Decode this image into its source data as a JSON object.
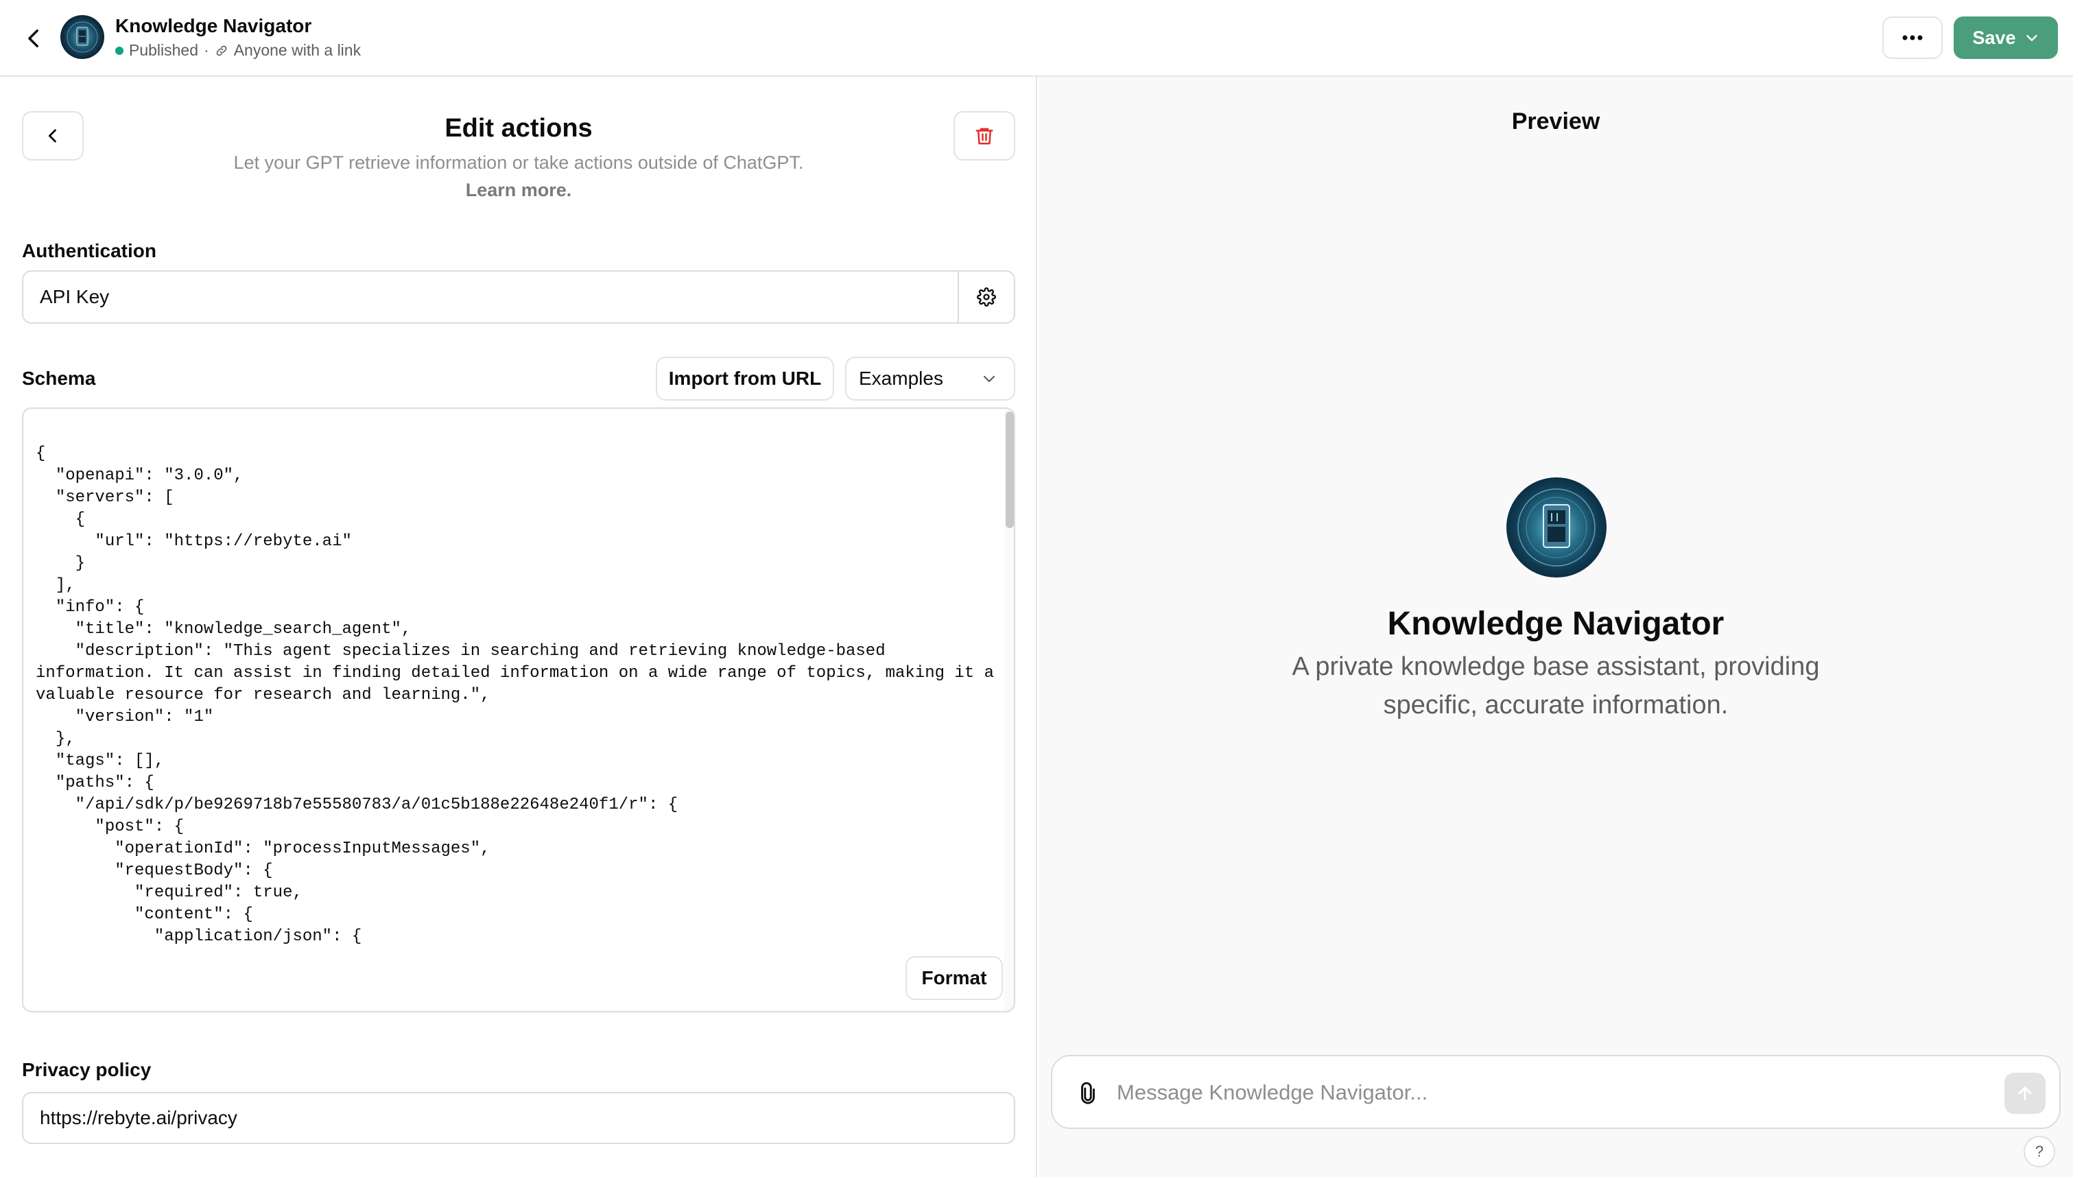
{
  "header": {
    "title": "Knowledge Navigator",
    "status": "Published",
    "separator": "·",
    "visibility": "Anyone with a link",
    "save_label": "Save"
  },
  "editor": {
    "title": "Edit actions",
    "subtitle": "Let your GPT retrieve information or take actions outside of ChatGPT.",
    "learn_more": "Learn more.",
    "authentication": {
      "label": "Authentication",
      "value": "API Key"
    },
    "schema": {
      "label": "Schema",
      "import_label": "Import from URL",
      "examples_label": "Examples",
      "format_label": "Format",
      "code": "{\n  \"openapi\": \"3.0.0\",\n  \"servers\": [\n    {\n      \"url\": \"https://rebyte.ai\"\n    }\n  ],\n  \"info\": {\n    \"title\": \"knowledge_search_agent\",\n    \"description\": \"This agent specializes in searching and retrieving knowledge-based information. It can assist in finding detailed information on a wide range of topics, making it a valuable resource for research and learning.\",\n    \"version\": \"1\"\n  },\n  \"tags\": [],\n  \"paths\": {\n    \"/api/sdk/p/be9269718b7e55580783/a/01c5b188e22648e240f1/r\": {\n      \"post\": {\n        \"operationId\": \"processInputMessages\",\n        \"requestBody\": {\n          \"required\": true,\n          \"content\": {\n            \"application/json\": {"
    },
    "privacy": {
      "label": "Privacy policy",
      "value": "https://rebyte.ai/privacy"
    }
  },
  "preview": {
    "title": "Preview",
    "name": "Knowledge Navigator",
    "description": "A private knowledge base assistant, providing specific, accurate information.",
    "input_placeholder": "Message Knowledge Navigator...",
    "help_label": "?"
  },
  "colors": {
    "save_button": "#4b9e7c",
    "status_dot": "#10a37f",
    "delete_icon": "#e02e2a"
  },
  "icons": {
    "back": "chevron-left-icon",
    "more": "ellipsis-icon",
    "delete": "trash-icon",
    "settings": "gear-icon",
    "attach": "paperclip-icon",
    "send": "arrow-up-icon",
    "link": "link-icon"
  }
}
